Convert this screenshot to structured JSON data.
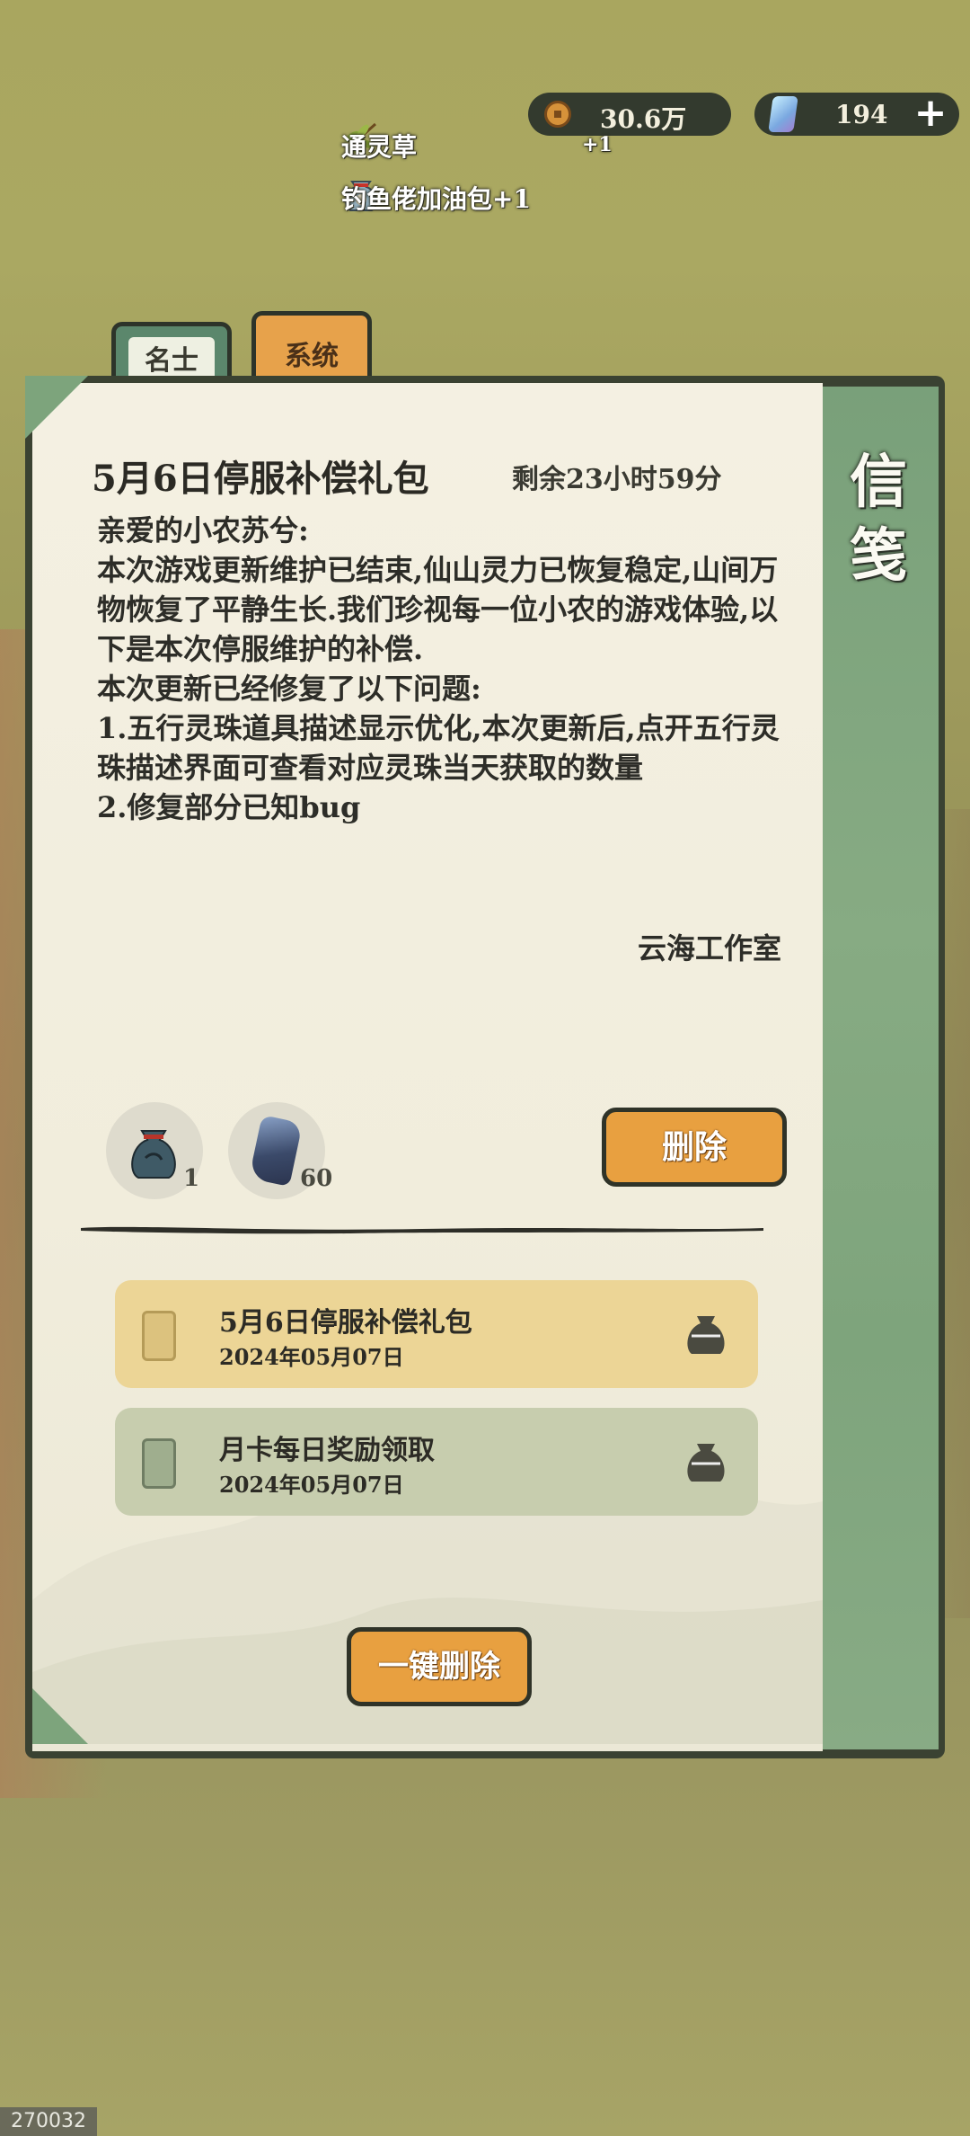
{
  "currency": {
    "coins": "30.6万",
    "gems": "194",
    "add_label": "+"
  },
  "rewards_toast": {
    "item1": "通灵草",
    "item1_count": "+1",
    "item2": "钓鱼佬加油包+1"
  },
  "tabs": [
    {
      "label": "名士"
    },
    {
      "label": "系统"
    }
  ],
  "panel_title": "信笺",
  "mail": {
    "title": "5月6日停服补偿礼包",
    "remaining": "剩余23小时59分",
    "body": "亲爱的小农苏兮:\n本次游戏更新维护已结束,仙山灵力已恢复稳定,山间万物恢复了平静生长.我们珍视每一位小农的游戏体验,以下是本次停服维护的补偿.\n本次更新已经修复了以下问题:\n1.五行灵珠道具描述显示优化,本次更新后,点开五行灵珠描述界面可查看对应灵珠当天获取的数量\n2.修复部分已知bug",
    "signature": "云海工作室",
    "attachments": [
      {
        "icon": "fishing-bag-icon",
        "count": "1"
      },
      {
        "icon": "spirit-stone-icon",
        "count": "60"
      }
    ],
    "delete_label": "删除"
  },
  "mail_list": [
    {
      "title": "5月6日停服补偿礼包",
      "date": "2024年05月07日",
      "icon": "gift-bag-icon",
      "selected": true
    },
    {
      "title": "月卡每日奖励领取",
      "date": "2024年05月07日",
      "icon": "gift-bag-icon",
      "selected": false
    }
  ],
  "delete_all_label": "一键删除",
  "screen_id": "270032",
  "colors": {
    "accent": "#e8a040",
    "tab_active": "#5b876c",
    "paper": "#f4f0e2"
  }
}
